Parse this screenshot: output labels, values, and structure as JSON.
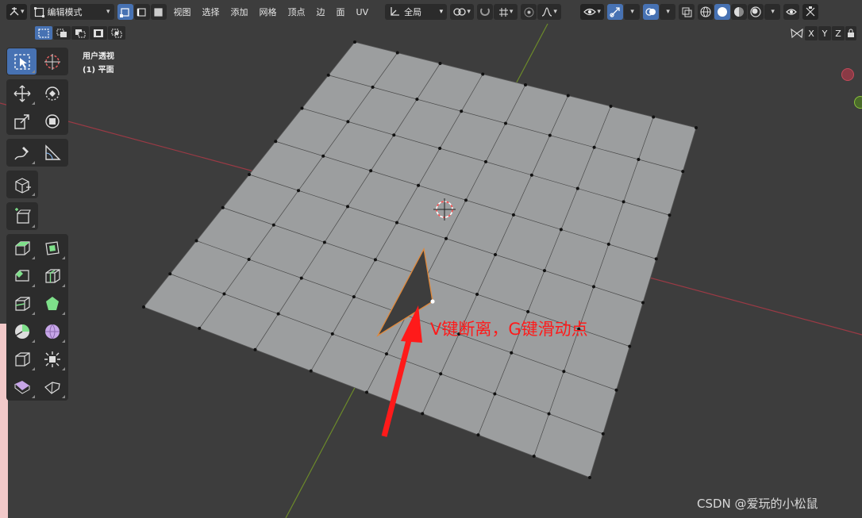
{
  "header": {
    "mode_label": "编辑模式",
    "menus": [
      "视图",
      "选择",
      "添加",
      "网格",
      "顶点",
      "边",
      "面",
      "UV"
    ],
    "orientation_label": "全局"
  },
  "axis_buttons": [
    "X",
    "Y",
    "Z"
  ],
  "viewport": {
    "view_name": "用户透视",
    "object_label": "(1) 平面"
  },
  "annotation": {
    "text": "V键断离，G键滑动点",
    "color": "#ff1a1a"
  },
  "watermark": "CSDN @爱玩的小松鼠",
  "colors": {
    "accent": "#4772b3",
    "background": "#3d3d3d",
    "mesh_face": "#9c9e9f",
    "x_axis": "#9b3a45",
    "y_axis": "#6c8a2a"
  },
  "toolbar_icons": [
    "select-box-icon",
    "cursor-icon",
    "move-icon",
    "rotate-icon",
    "scale-icon",
    "transform-icon",
    "annotate-icon",
    "measure-icon",
    "add-cube-icon",
    "extrude-region-icon",
    "extrude-icon",
    "inset-faces-icon",
    "bevel-icon",
    "loop-cut-icon",
    "knife-icon",
    "poly-build-icon",
    "spin-icon",
    "smooth-icon",
    "edge-slide-icon",
    "shrink-fatten-icon",
    "shear-icon",
    "rip-region-icon"
  ]
}
